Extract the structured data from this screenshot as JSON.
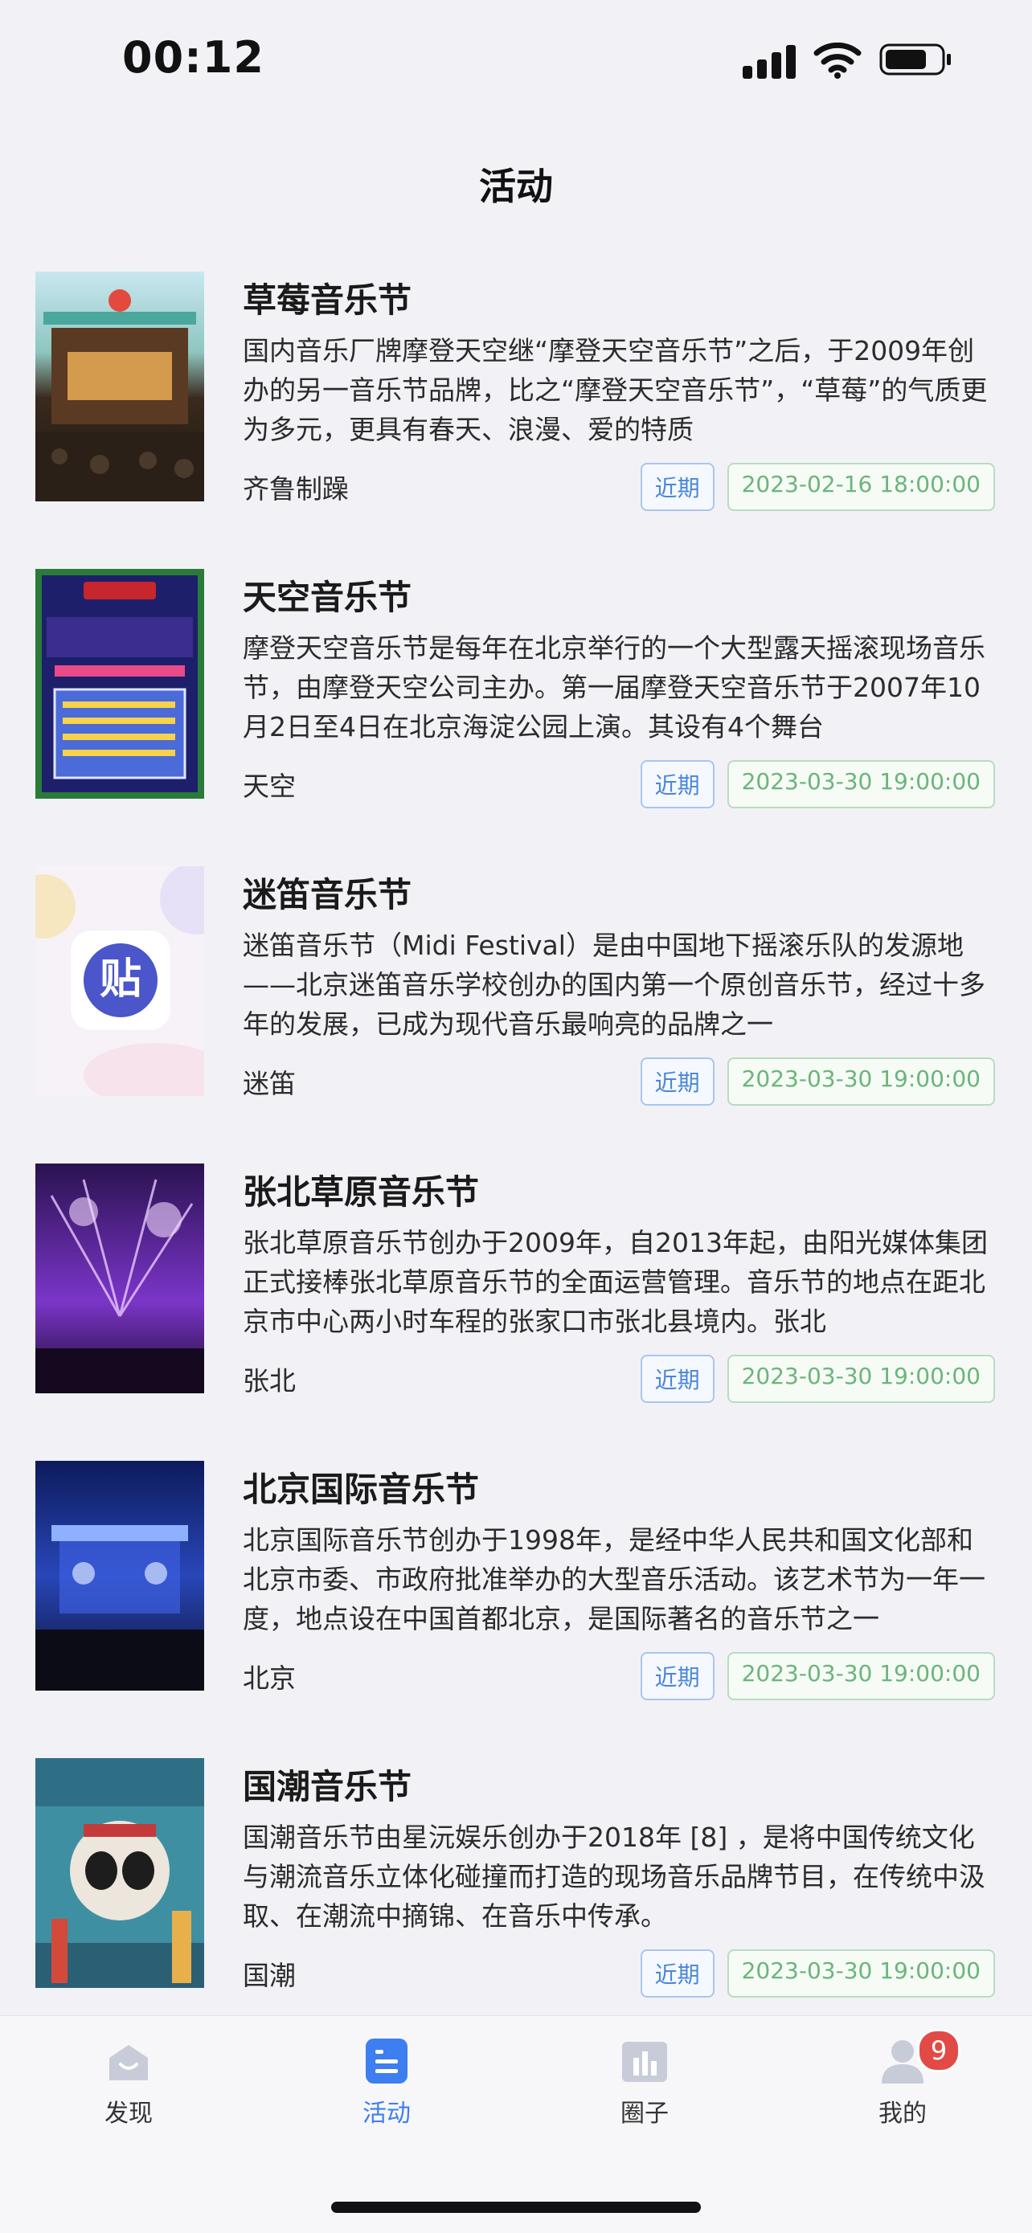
{
  "status_bar": {
    "time": "00:12"
  },
  "page_title": "活动",
  "events": [
    {
      "title": "草莓音乐节",
      "description": "国内音乐厂牌摩登天空继“摩登天空音乐节”之后，于2009年创办的另一音乐节品牌，比之“摩登天空音乐节”，“草莓”的气质更为多元，更具有春天、浪漫、爱的特质",
      "place": "齐鲁制躁",
      "tag": "近期",
      "datetime": "2023-02-16 18:00:00"
    },
    {
      "title": "天空音乐节",
      "description": "摩登天空音乐节是每年在北京举行的一个大型露天摇滚现场音乐节，由摩登天空公司主办。第一届摩登天空音乐节于2007年10月2日至4日在北京海淀公园上演。其设有4个舞台",
      "place": "天空",
      "tag": "近期",
      "datetime": "2023-03-30 19:00:00"
    },
    {
      "title": "迷笛音乐节",
      "description": "迷笛音乐节（Midi Festival）是由中国地下摇滚乐队的发源地——北京迷笛音乐学校创办的国内第一个原创音乐节，经过十多年的发展，已成为现代音乐最响亮的品牌之一",
      "place": "迷笛",
      "tag": "近期",
      "datetime": "2023-03-30 19:00:00"
    },
    {
      "title": "张北草原音乐节",
      "description": "张北草原音乐节创办于2009年，自2013年起，由阳光媒体集团正式接棒张北草原音乐节的全面运营管理。音乐节的地点在距北京市中心两小时车程的张家口市张北县境内。张北",
      "place": "张北",
      "tag": "近期",
      "datetime": "2023-03-30 19:00:00"
    },
    {
      "title": "北京国际音乐节",
      "description": "北京国际音乐节创办于1998年，是经中华人民共和国文化部和北京市委、市政府批准举办的大型音乐活动。该艺术节为一年一度，地点设在中国首都北京，是国际著名的音乐节之一",
      "place": "北京",
      "tag": "近期",
      "datetime": "2023-03-30 19:00:00"
    },
    {
      "title": "国潮音乐节",
      "description": "国潮音乐节由星沅娱乐创办于2018年 [8] ，是将中国传统文化与潮流音乐立体化碰撞而打造的现场音乐品牌节目，在传统中汲取、在潮流中摘锦、在音乐中传承。",
      "place": "国潮",
      "tag": "近期",
      "datetime": "2023-03-30 19:00:00"
    }
  ],
  "tabs": [
    {
      "label": "发现",
      "icon": "home-icon"
    },
    {
      "label": "活动",
      "icon": "list-icon",
      "active": true
    },
    {
      "label": "圈子",
      "icon": "chart-icon"
    },
    {
      "label": "我的",
      "icon": "user-icon",
      "badge": "9"
    }
  ],
  "colors": {
    "accent": "#3d7ef0",
    "date_green": "#6bb57a",
    "badge_red": "#e24a45"
  }
}
